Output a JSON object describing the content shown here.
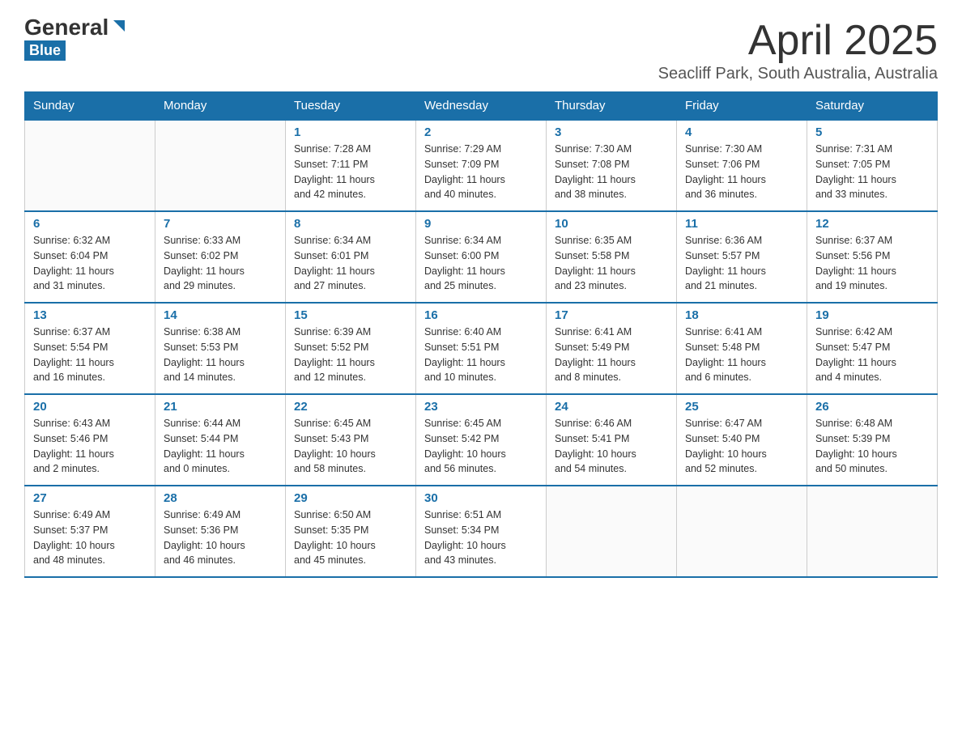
{
  "header": {
    "logo_general": "General",
    "logo_blue": "Blue",
    "month_year": "April 2025",
    "location": "Seacliff Park, South Australia, Australia"
  },
  "weekdays": [
    "Sunday",
    "Monday",
    "Tuesday",
    "Wednesday",
    "Thursday",
    "Friday",
    "Saturday"
  ],
  "weeks": [
    [
      {
        "day": "",
        "info": ""
      },
      {
        "day": "",
        "info": ""
      },
      {
        "day": "1",
        "info": "Sunrise: 7:28 AM\nSunset: 7:11 PM\nDaylight: 11 hours\nand 42 minutes."
      },
      {
        "day": "2",
        "info": "Sunrise: 7:29 AM\nSunset: 7:09 PM\nDaylight: 11 hours\nand 40 minutes."
      },
      {
        "day": "3",
        "info": "Sunrise: 7:30 AM\nSunset: 7:08 PM\nDaylight: 11 hours\nand 38 minutes."
      },
      {
        "day": "4",
        "info": "Sunrise: 7:30 AM\nSunset: 7:06 PM\nDaylight: 11 hours\nand 36 minutes."
      },
      {
        "day": "5",
        "info": "Sunrise: 7:31 AM\nSunset: 7:05 PM\nDaylight: 11 hours\nand 33 minutes."
      }
    ],
    [
      {
        "day": "6",
        "info": "Sunrise: 6:32 AM\nSunset: 6:04 PM\nDaylight: 11 hours\nand 31 minutes."
      },
      {
        "day": "7",
        "info": "Sunrise: 6:33 AM\nSunset: 6:02 PM\nDaylight: 11 hours\nand 29 minutes."
      },
      {
        "day": "8",
        "info": "Sunrise: 6:34 AM\nSunset: 6:01 PM\nDaylight: 11 hours\nand 27 minutes."
      },
      {
        "day": "9",
        "info": "Sunrise: 6:34 AM\nSunset: 6:00 PM\nDaylight: 11 hours\nand 25 minutes."
      },
      {
        "day": "10",
        "info": "Sunrise: 6:35 AM\nSunset: 5:58 PM\nDaylight: 11 hours\nand 23 minutes."
      },
      {
        "day": "11",
        "info": "Sunrise: 6:36 AM\nSunset: 5:57 PM\nDaylight: 11 hours\nand 21 minutes."
      },
      {
        "day": "12",
        "info": "Sunrise: 6:37 AM\nSunset: 5:56 PM\nDaylight: 11 hours\nand 19 minutes."
      }
    ],
    [
      {
        "day": "13",
        "info": "Sunrise: 6:37 AM\nSunset: 5:54 PM\nDaylight: 11 hours\nand 16 minutes."
      },
      {
        "day": "14",
        "info": "Sunrise: 6:38 AM\nSunset: 5:53 PM\nDaylight: 11 hours\nand 14 minutes."
      },
      {
        "day": "15",
        "info": "Sunrise: 6:39 AM\nSunset: 5:52 PM\nDaylight: 11 hours\nand 12 minutes."
      },
      {
        "day": "16",
        "info": "Sunrise: 6:40 AM\nSunset: 5:51 PM\nDaylight: 11 hours\nand 10 minutes."
      },
      {
        "day": "17",
        "info": "Sunrise: 6:41 AM\nSunset: 5:49 PM\nDaylight: 11 hours\nand 8 minutes."
      },
      {
        "day": "18",
        "info": "Sunrise: 6:41 AM\nSunset: 5:48 PM\nDaylight: 11 hours\nand 6 minutes."
      },
      {
        "day": "19",
        "info": "Sunrise: 6:42 AM\nSunset: 5:47 PM\nDaylight: 11 hours\nand 4 minutes."
      }
    ],
    [
      {
        "day": "20",
        "info": "Sunrise: 6:43 AM\nSunset: 5:46 PM\nDaylight: 11 hours\nand 2 minutes."
      },
      {
        "day": "21",
        "info": "Sunrise: 6:44 AM\nSunset: 5:44 PM\nDaylight: 11 hours\nand 0 minutes."
      },
      {
        "day": "22",
        "info": "Sunrise: 6:45 AM\nSunset: 5:43 PM\nDaylight: 10 hours\nand 58 minutes."
      },
      {
        "day": "23",
        "info": "Sunrise: 6:45 AM\nSunset: 5:42 PM\nDaylight: 10 hours\nand 56 minutes."
      },
      {
        "day": "24",
        "info": "Sunrise: 6:46 AM\nSunset: 5:41 PM\nDaylight: 10 hours\nand 54 minutes."
      },
      {
        "day": "25",
        "info": "Sunrise: 6:47 AM\nSunset: 5:40 PM\nDaylight: 10 hours\nand 52 minutes."
      },
      {
        "day": "26",
        "info": "Sunrise: 6:48 AM\nSunset: 5:39 PM\nDaylight: 10 hours\nand 50 minutes."
      }
    ],
    [
      {
        "day": "27",
        "info": "Sunrise: 6:49 AM\nSunset: 5:37 PM\nDaylight: 10 hours\nand 48 minutes."
      },
      {
        "day": "28",
        "info": "Sunrise: 6:49 AM\nSunset: 5:36 PM\nDaylight: 10 hours\nand 46 minutes."
      },
      {
        "day": "29",
        "info": "Sunrise: 6:50 AM\nSunset: 5:35 PM\nDaylight: 10 hours\nand 45 minutes."
      },
      {
        "day": "30",
        "info": "Sunrise: 6:51 AM\nSunset: 5:34 PM\nDaylight: 10 hours\nand 43 minutes."
      },
      {
        "day": "",
        "info": ""
      },
      {
        "day": "",
        "info": ""
      },
      {
        "day": "",
        "info": ""
      }
    ]
  ]
}
